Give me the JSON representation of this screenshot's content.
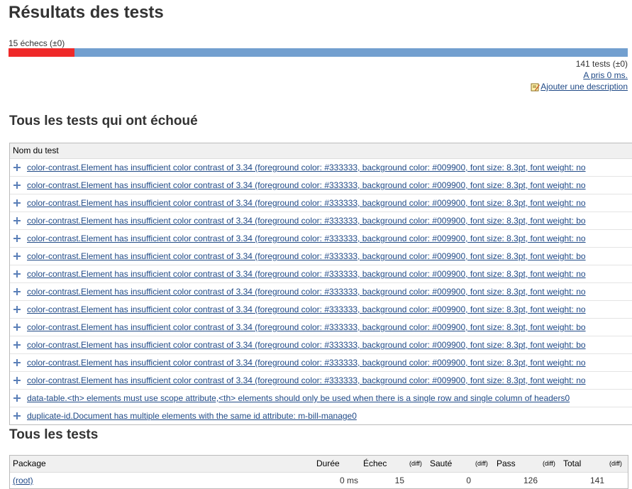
{
  "page_title": "Résultats des tests",
  "summary": {
    "failures_text": "15 échecs (±0)",
    "failed_fraction": 0.1064,
    "total_text": "141 tests (±0)",
    "took_text": "A pris 0 ms.",
    "add_description": "Ajouter une description"
  },
  "colors": {
    "fail": "#EF2929",
    "pass": "#729FCF",
    "link": "#204A87"
  },
  "failed_section": {
    "heading": "Tous les tests qui ont échoué",
    "column_header": "Nom du test",
    "rows": [
      "color-contrast.Element has insufficient color contrast of 3.34 (foreground color: #333333, background color: #009900, font size: 8.3pt, font weight: no",
      "color-contrast.Element has insufficient color contrast of 3.34 (foreground color: #333333, background color: #009900, font size: 8.3pt, font weight: no",
      "color-contrast.Element has insufficient color contrast of 3.34 (foreground color: #333333, background color: #009900, font size: 8.3pt, font weight: no",
      "color-contrast.Element has insufficient color contrast of 3.34 (foreground color: #333333, background color: #009900, font size: 8.3pt, font weight: bo",
      "color-contrast.Element has insufficient color contrast of 3.34 (foreground color: #333333, background color: #009900, font size: 8.3pt, font weight: no",
      "color-contrast.Element has insufficient color contrast of 3.34 (foreground color: #333333, background color: #009900, font size: 8.3pt, font weight: bo",
      "color-contrast.Element has insufficient color contrast of 3.34 (foreground color: #333333, background color: #009900, font size: 8.3pt, font weight: no",
      "color-contrast.Element has insufficient color contrast of 3.34 (foreground color: #333333, background color: #009900, font size: 8.3pt, font weight: no",
      "color-contrast.Element has insufficient color contrast of 3.34 (foreground color: #333333, background color: #009900, font size: 8.3pt, font weight: no",
      "color-contrast.Element has insufficient color contrast of 3.34 (foreground color: #333333, background color: #009900, font size: 8.3pt, font weight: bo",
      "color-contrast.Element has insufficient color contrast of 3.34 (foreground color: #333333, background color: #009900, font size: 8.3pt, font weight: bo",
      "color-contrast.Element has insufficient color contrast of 3.34 (foreground color: #333333, background color: #009900, font size: 8.3pt, font weight: no",
      "color-contrast.Element has insufficient color contrast of 3.34 (foreground color: #333333, background color: #009900, font size: 8.3pt, font weight: no",
      "data-table.<th> elements must use scope attribute,<th> elements should only be used when there is a single row and single column of headers0",
      "duplicate-id.Document has multiple elements with the same id attribute: m-bill-manage0"
    ]
  },
  "all_section": {
    "heading": "Tous les tests",
    "headers": {
      "package": "Package",
      "duration": "Durée",
      "fail": "Échec",
      "diff": "(diff)",
      "skip": "Sauté",
      "pass": "Pass",
      "total": "Total"
    },
    "row": {
      "package": "(root)",
      "duration": "0 ms",
      "fail": "15",
      "skip": "0",
      "pass": "126",
      "total": "141"
    }
  }
}
